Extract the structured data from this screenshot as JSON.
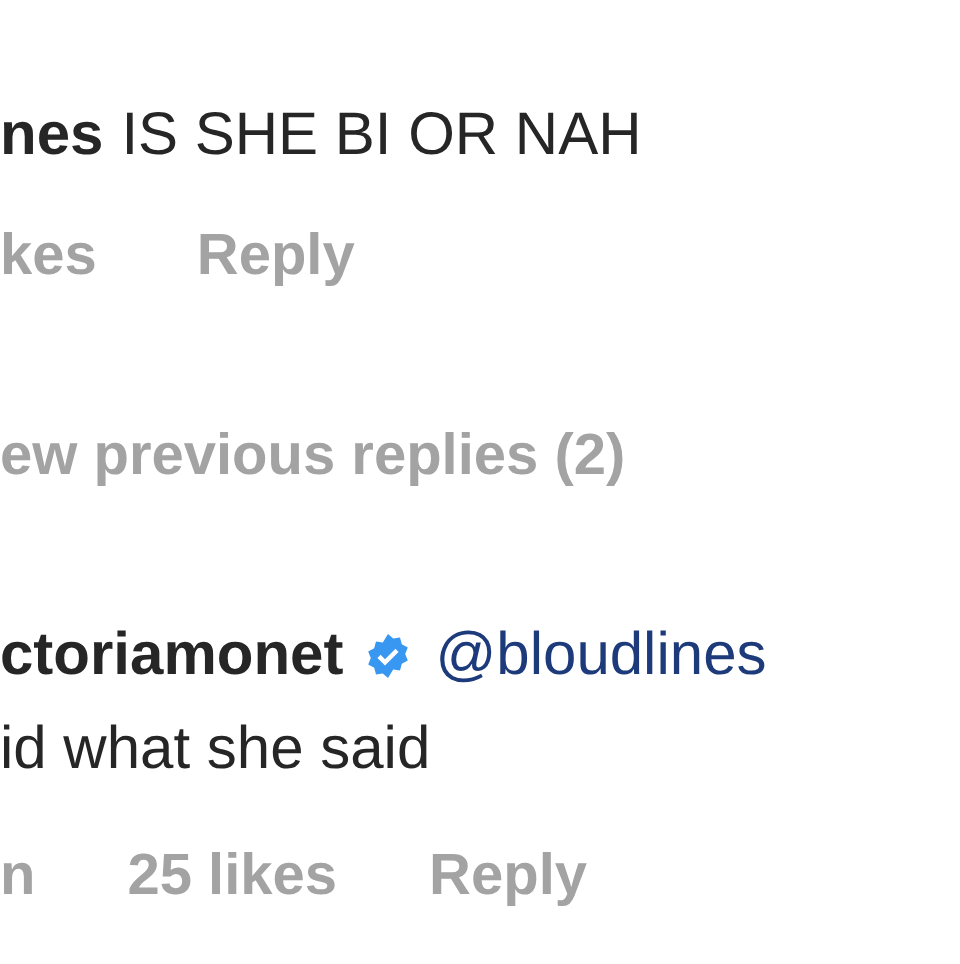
{
  "comment": {
    "username": "nes",
    "text": "IS SHE BI OR NAH",
    "meta": [
      "kes",
      "Reply"
    ]
  },
  "view_replies": "ew previous replies (2)",
  "reply": {
    "username": "ctoriamonet",
    "verified": true,
    "mention": "@bloudlines",
    "text": "id what she said",
    "meta": [
      "n",
      "25 likes",
      "Reply"
    ]
  }
}
